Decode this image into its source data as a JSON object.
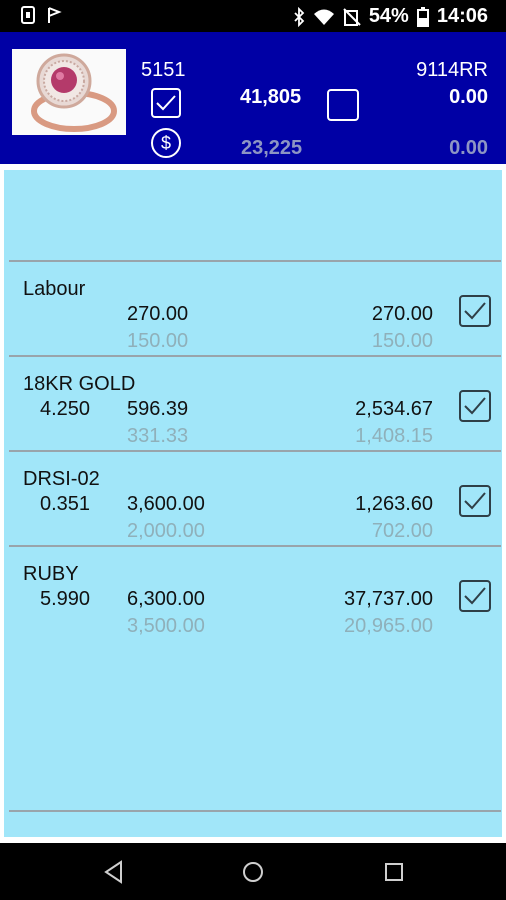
{
  "status_bar": {
    "battery": "54%",
    "time": "14:06",
    "icons": [
      "bluetooth-icon",
      "wifi-icon",
      "no-sim-icon",
      "battery-icon"
    ]
  },
  "header": {
    "code": "5151",
    "ref": "9114RR",
    "total": "41,805",
    "total_right": "0.00",
    "cost": "23,225",
    "cost_right": "0.00",
    "checked": true
  },
  "items": [
    {
      "name": "Labour",
      "qty": "",
      "rate": "270.00",
      "amount": "270.00",
      "rate_cost": "150.00",
      "amount_cost": "150.00",
      "checked": true
    },
    {
      "name": "18KR GOLD",
      "qty": "4.250",
      "rate": "596.39",
      "amount": "2,534.67",
      "rate_cost": "331.33",
      "amount_cost": "1,408.15",
      "checked": true
    },
    {
      "name": "DRSI-02",
      "qty": "0.351",
      "rate": "3,600.00",
      "amount": "1,263.60",
      "rate_cost": "2,000.00",
      "amount_cost": "702.00",
      "checked": true
    },
    {
      "name": "RUBY",
      "qty": "5.990",
      "rate": "6,300.00",
      "amount": "37,737.00",
      "rate_cost": "3,500.00",
      "amount_cost": "20,965.00",
      "checked": true
    }
  ],
  "colors": {
    "header_bg": "#0000a5",
    "content_bg": "#a1e6f9",
    "cost_text": "#8fb0ba"
  }
}
